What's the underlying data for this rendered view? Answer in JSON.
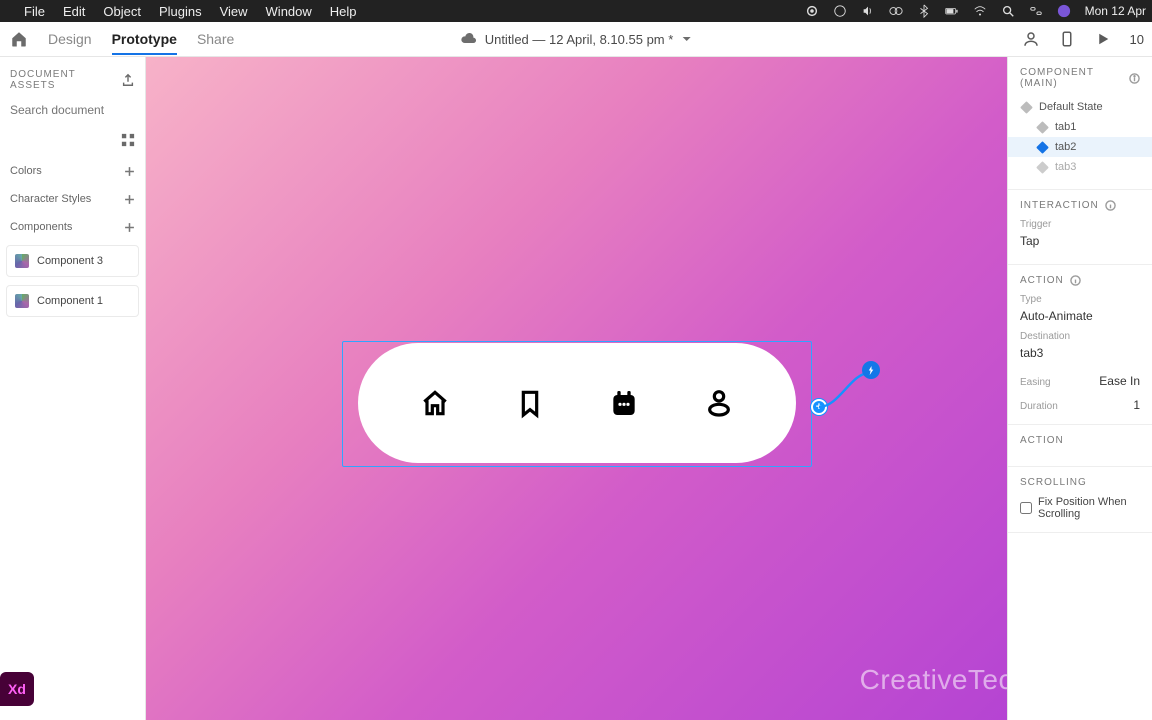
{
  "mac_menu": {
    "items": [
      "File",
      "Edit",
      "Object",
      "Plugins",
      "View",
      "Window",
      "Help"
    ],
    "clock": "Mon 12 Apr"
  },
  "toolbar": {
    "tabs": {
      "design": "Design",
      "prototype": "Prototype",
      "share": "Share"
    },
    "title": "Untitled — 12 April, 8.10.55 pm *",
    "zoom": "10"
  },
  "left": {
    "title": "DOCUMENT ASSETS",
    "search_placeholder": "Search document",
    "groups": {
      "colors": "Colors",
      "char": "Character Styles",
      "comp": "Components"
    },
    "components": [
      "Component 3",
      "Component 1"
    ],
    "badge": "Xd"
  },
  "canvas": {
    "watermark": "CreativeTec"
  },
  "right": {
    "comp_title": "COMPONENT (MAIN)",
    "states": {
      "default": "Default State",
      "t1": "tab1",
      "t2": "tab2",
      "t3": "tab3"
    },
    "interaction_title": "INTERACTION",
    "trigger_label": "Trigger",
    "trigger_value": "Tap",
    "action_title": "ACTION",
    "type_label": "Type",
    "type_value": "Auto-Animate",
    "dest_label": "Destination",
    "dest_value": "tab3",
    "easing_label": "Easing",
    "easing_value": "Ease In",
    "duration_label": "Duration",
    "duration_value": "1",
    "action2_title": "ACTION",
    "scroll_title": "SCROLLING",
    "scroll_fix": "Fix Position When Scrolling"
  }
}
